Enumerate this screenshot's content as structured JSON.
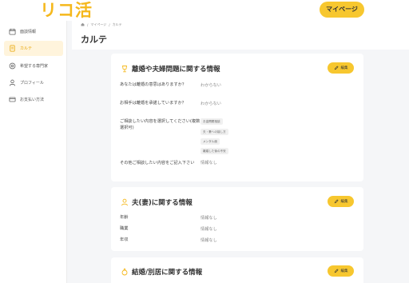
{
  "header": {
    "logo": "リコ活",
    "mypage_button": "マイページ"
  },
  "sidebar": {
    "items": [
      {
        "label": "面談情報",
        "icon": "calendar-icon",
        "active": false
      },
      {
        "label": "カルテ",
        "icon": "document-icon",
        "active": true
      },
      {
        "label": "希望する専門家",
        "icon": "handshake-icon",
        "active": false
      },
      {
        "label": "プロフィール",
        "icon": "user-icon",
        "active": false
      },
      {
        "label": "お支払い方法",
        "icon": "credit-card-icon",
        "active": false
      }
    ]
  },
  "breadcrumb": {
    "items": [
      "マイページ",
      "カルテ"
    ]
  },
  "page_title": "カルテ",
  "cards": {
    "divorce": {
      "title": "離婚や夫婦問題に関する情報",
      "edit": "編集",
      "rows": [
        {
          "label": "あなたは離婚の意思はありますか？",
          "value": "わからない"
        },
        {
          "label": "お相手は離婚を承諾していますか？",
          "value": "わからない"
        },
        {
          "label": "ご相談したい内容を選択してください(複数選択可)",
          "tags": [
            "お金問題相談",
            "夫・妻への接し方",
            "メンタル面",
            "離婚した後の不安"
          ]
        },
        {
          "label": "その他ご相談したい内容をご記入下さい",
          "value": "情報なし"
        }
      ]
    },
    "spouse": {
      "title": "夫(妻)に関する情報",
      "edit": "編集",
      "rows": [
        {
          "label": "年齢",
          "value": "情報なし"
        },
        {
          "label": "職業",
          "value": "情報なし"
        },
        {
          "label": "年収",
          "value": "情報なし"
        }
      ]
    },
    "marriage": {
      "title": "結婚/別居に関する情報",
      "edit": "編集"
    }
  },
  "colors": {
    "accent": "#f7c72f",
    "logo": "#f5b81c",
    "active_bg": "#fff4dc",
    "background": "#f5f6f8"
  }
}
